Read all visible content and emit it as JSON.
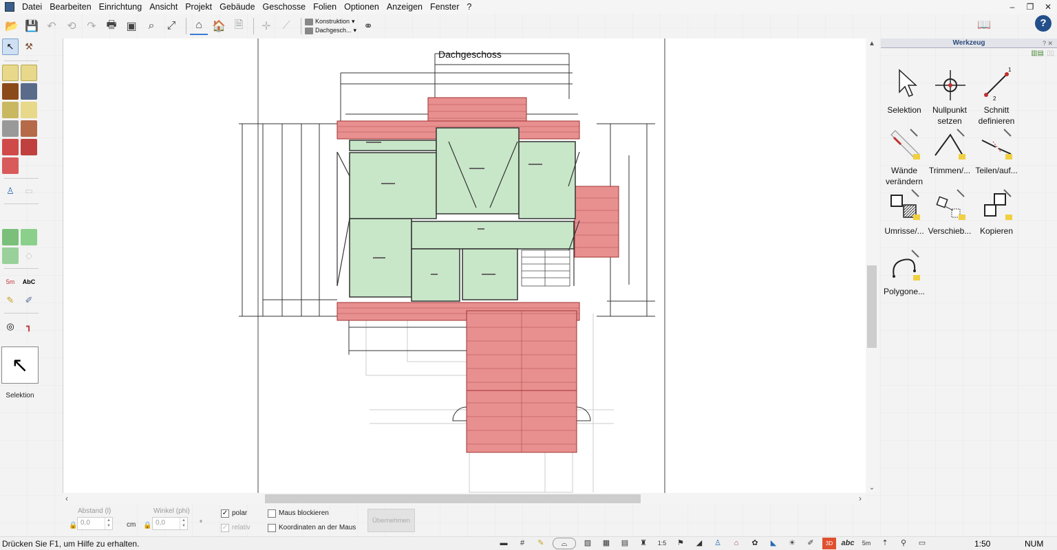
{
  "menu": [
    "Datei",
    "Bearbeiten",
    "Einrichtung",
    "Ansicht",
    "Projekt",
    "Gebäude",
    "Geschosse",
    "Folien",
    "Optionen",
    "Anzeigen",
    "Fenster",
    "?"
  ],
  "toolbar": {
    "dropdown_top": "Konstruktion",
    "dropdown_bottom": "Dachgesch..."
  },
  "palette": {
    "selected_tool_label": "Selektion"
  },
  "drawing": {
    "floor_title": "Dachgeschoss"
  },
  "inputs": {
    "abstand_label": "Abstand (l)",
    "abstand_value": "0,0",
    "abstand_unit": "cm",
    "winkel_label": "Winkel (phi)",
    "winkel_value": "0,0",
    "winkel_unit": "°",
    "polar_label": "polar",
    "polar_checked": true,
    "relativ_label": "relativ",
    "maus_blockieren_label": "Maus blockieren",
    "koordinaten_label": "Koordinaten an der Maus",
    "apply_label": "Übernehmen"
  },
  "panel": {
    "title": "Werkzeug",
    "tools": [
      {
        "label": "Selektion",
        "icon": "cursor-icon"
      },
      {
        "label": "Nullpunkt setzen",
        "icon": "crosshair-icon"
      },
      {
        "label": "Schnitt definieren",
        "icon": "section-line-icon"
      },
      {
        "label": "Wände verändern",
        "icon": "wall-edit-icon"
      },
      {
        "label": "Trimmen/...",
        "icon": "trim-icon"
      },
      {
        "label": "Teilen/auf...",
        "icon": "split-icon"
      },
      {
        "label": "Umrisse/...",
        "icon": "outline-icon"
      },
      {
        "label": "Verschieb...",
        "icon": "move-icon"
      },
      {
        "label": "Kopieren",
        "icon": "copy-icon"
      },
      {
        "label": "Polygone...",
        "icon": "polygon-icon"
      }
    ]
  },
  "status": {
    "help_text": "Drücken Sie F1, um Hilfe zu erhalten.",
    "scale": "1:50",
    "num": "NUM"
  }
}
